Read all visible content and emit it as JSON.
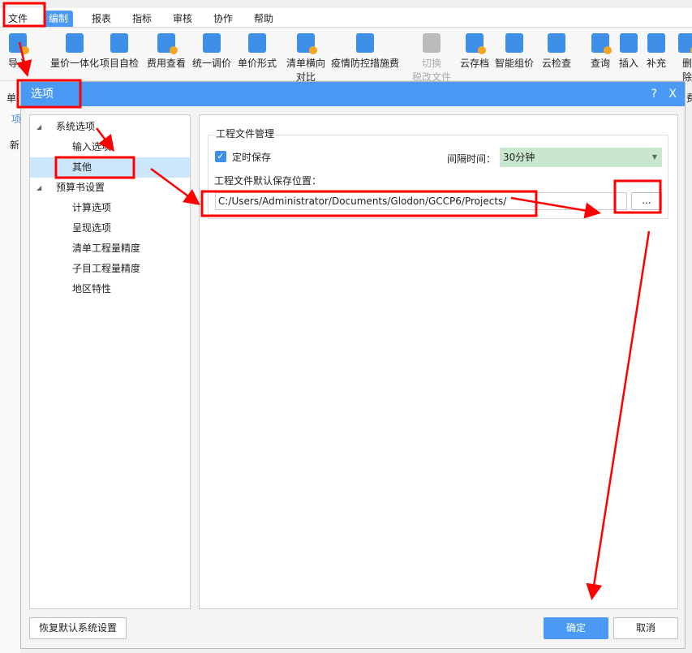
{
  "menubar": {
    "items": [
      "文件",
      "编制",
      "报表",
      "指标",
      "审核",
      "协作",
      "帮助"
    ],
    "active": "编制"
  },
  "ribbon": {
    "buttons": [
      {
        "label": "导入",
        "icon": "import-icon"
      },
      {
        "label": "量价一体化",
        "icon": "integration-icon"
      },
      {
        "label": "项目自检",
        "icon": "self-check-icon"
      },
      {
        "label": "费用查看",
        "icon": "cost-view-icon"
      },
      {
        "label": "统一调价",
        "icon": "price-adjust-icon"
      },
      {
        "label": "单价形式",
        "icon": "unit-price-icon"
      },
      {
        "label": "清单横向",
        "label2": "对比",
        "icon": "compare-icon"
      },
      {
        "label": "疫情防控措施费",
        "icon": "epidemic-fee-icon"
      },
      {
        "label": "切换",
        "label2": "税改文件",
        "icon": "tax-switch-icon",
        "disabled": true
      },
      {
        "label": "云存档",
        "icon": "cloud-save-icon"
      },
      {
        "label": "智能组价",
        "icon": "smart-price-icon"
      },
      {
        "label": "云检查",
        "icon": "cloud-check-icon"
      },
      {
        "label": "查询",
        "icon": "query-icon"
      },
      {
        "label": "插入",
        "icon": "insert-icon"
      },
      {
        "label": "补充",
        "icon": "supplement-icon"
      },
      {
        "label": "删除",
        "icon": "delete-icon"
      }
    ]
  },
  "background": {
    "left": [
      "单",
      "项",
      "新"
    ],
    "right": "费"
  },
  "dialog": {
    "title": "选项",
    "help": "?",
    "close": "X",
    "tree": [
      {
        "label": "系统选项",
        "level": 1,
        "expanded": true
      },
      {
        "label": "输入选项",
        "level": 2
      },
      {
        "label": "其他",
        "level": 2,
        "selected": true
      },
      {
        "label": "预算书设置",
        "level": 1,
        "expanded": true
      },
      {
        "label": "计算选项",
        "level": 2
      },
      {
        "label": "呈现选项",
        "level": 2
      },
      {
        "label": "清单工程量精度",
        "level": 2
      },
      {
        "label": "子目工程量精度",
        "level": 2
      },
      {
        "label": "地区特性",
        "level": 2
      }
    ],
    "panel": {
      "group_title": "工程文件管理",
      "auto_save_label": "定时保存",
      "auto_save_checked": true,
      "interval_label": "间隔时间：",
      "interval_value": "30分钟",
      "path_label": "工程文件默认保存位置：",
      "path_value": "C:/Users/Administrator/Documents/Glodon/GCCP6/Projects/",
      "browse_label": "..."
    },
    "restore_label": "恢复默认系统设置",
    "ok_label": "确定",
    "cancel_label": "取消"
  },
  "colors": {
    "accent": "#4a9af5",
    "selection": "#cce6fb",
    "annotation": "#ff0000",
    "select_bg": "#c9e7cc"
  }
}
